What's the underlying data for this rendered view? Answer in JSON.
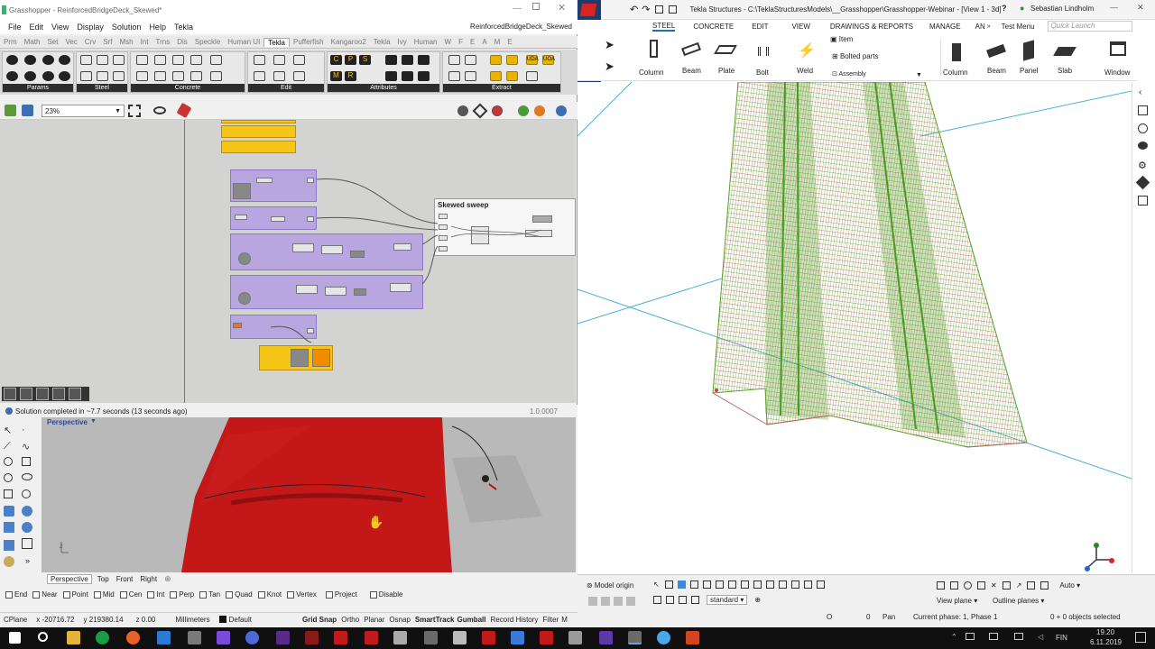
{
  "gh": {
    "title": "Grasshopper - ReinforcedBridgeDeck_Skewed*",
    "right_title": "ReinforcedBridgeDeck_Skewed",
    "menu": [
      "File",
      "Edit",
      "View",
      "Display",
      "Solution",
      "Help",
      "Tekla"
    ],
    "tabs": [
      "Prm",
      "Math",
      "Set",
      "Vec",
      "Crv",
      "Srf",
      "Msh",
      "Int",
      "Trns",
      "Dis",
      "Speckle",
      "Human UI",
      "Tekla",
      "Pufferfish",
      "Kangaroo2",
      "Tekla",
      "Ivy",
      "Human",
      "W",
      "F",
      "E",
      "A",
      "M",
      "E"
    ],
    "active_tab_index": 12,
    "ribbon_groups": [
      "Params",
      "Steel",
      "Concrete",
      "Edit",
      "Attributes",
      "Extract"
    ],
    "ribbon_letters": [
      "C",
      "P",
      "S",
      "M",
      "R",
      "UDA",
      "UOA"
    ],
    "zoom": "23%",
    "group_title": "Skewed sweep",
    "status": "Solution completed in ~7.7 seconds (13 seconds ago)",
    "version": "1.0.0007",
    "accent_purple": "#b7a6e0",
    "accent_yellow": "#f5c518"
  },
  "rhino": {
    "viewport_label": "Perspective",
    "view_tabs": [
      "Perspective",
      "Top",
      "Front",
      "Right"
    ],
    "snaps": [
      "End",
      "Near",
      "Point",
      "Mid",
      "Cen",
      "Int",
      "Perp",
      "Tan",
      "Quad",
      "Knot",
      "Vertex",
      "Project",
      "Disable"
    ],
    "status": {
      "cplane": "CPlane",
      "x": "x -20716.72",
      "y": "y 219380.14",
      "z": "z 0.00",
      "units": "Millimeters",
      "layer": "Default",
      "toggles": [
        "Grid Snap",
        "Ortho",
        "Planar",
        "Osnap",
        "SmartTrack",
        "Gumball",
        "Record History",
        "Filter",
        "M"
      ]
    }
  },
  "tekla": {
    "title": "Tekla Structures - C:\\TeklaStructuresModels\\__Grasshopper\\Grasshopper-Webinar - [View 1 - 3d]",
    "user": "Sebastian Lindholm",
    "quick_launch": "Quick Launch",
    "tabs": [
      "STEEL",
      "CONCRETE",
      "EDIT",
      "VIEW",
      "DRAWINGS & REPORTS",
      "MANAGE",
      "AN"
    ],
    "test_menu": "Test Menu",
    "ribbon_steel": [
      "Column",
      "Beam",
      "Plate",
      "Bolt",
      "Weld"
    ],
    "ribbon_misc": [
      "Item",
      "Bolted parts",
      "Assembly"
    ],
    "ribbon_concrete": [
      "Column",
      "Beam",
      "Panel",
      "Slab"
    ],
    "window_label": "Window",
    "bottom": {
      "model_origin": "Model origin",
      "standard": "standard",
      "view_plane": "View plane",
      "outline_planes": "Outline planes",
      "auto": "Auto"
    },
    "status": {
      "o": "O",
      "zero": "0",
      "pan": "Pan",
      "phase": "Current phase: 1, Phase 1",
      "selected": "0 + 0 objects selected"
    },
    "mesh_green": "#5aa028",
    "mesh_red": "#d04040"
  },
  "taskbar": {
    "lang": "FIN",
    "time": "19.20",
    "date": "6.11.2019"
  }
}
